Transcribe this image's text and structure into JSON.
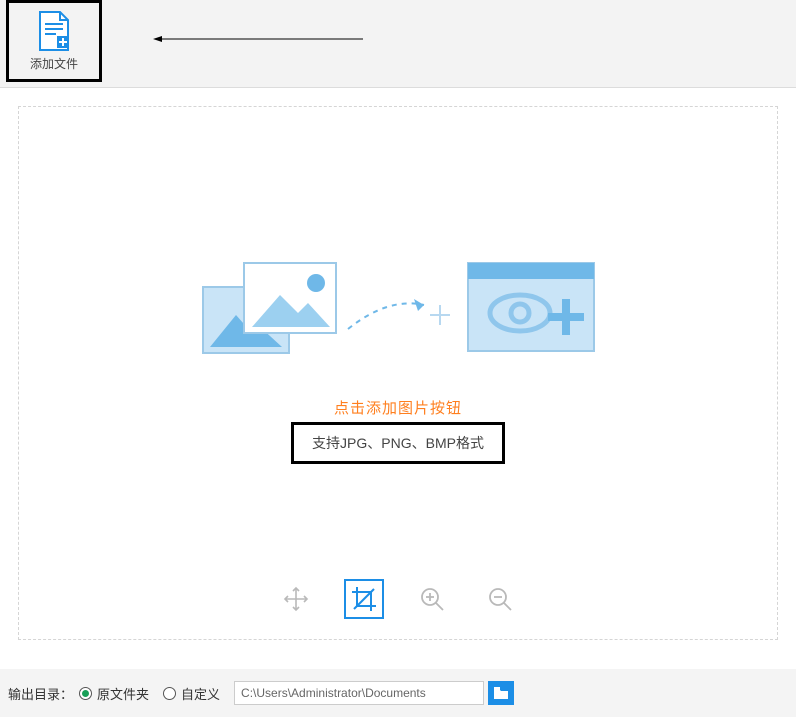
{
  "toolbar": {
    "add_file_label": "添加文件"
  },
  "drop": {
    "prompt": "点击添加图片按钮",
    "formats": "支持JPG、PNG、BMP格式"
  },
  "footer": {
    "output_dir_label": "输出目录：",
    "source_folder_label": "原文件夹",
    "custom_label": "自定义",
    "path_value": "C:\\Users\\Administrator\\Documents"
  }
}
